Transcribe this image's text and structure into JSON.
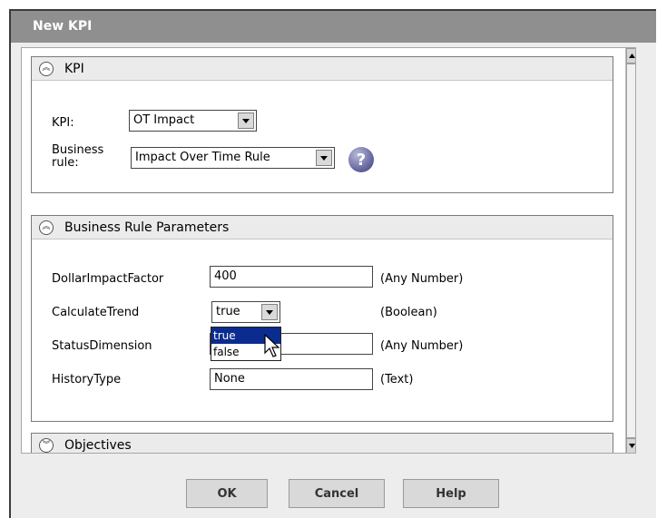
{
  "dialog": {
    "title": "New KPI"
  },
  "kpi_section": {
    "title": "KPI",
    "kpi_label": "KPI:",
    "kpi_value": "OT Impact",
    "business_rule_label_1": "Business",
    "business_rule_label_2": "rule:",
    "business_rule_value": "Impact Over Time Rule",
    "help_icon": "question-icon"
  },
  "params_section": {
    "title": "Business Rule Parameters",
    "rows": [
      {
        "name": "DollarImpactFactor",
        "value": "400",
        "type": "(Any Number)"
      },
      {
        "name": "CalculateTrend",
        "value": "true",
        "type": "(Boolean)"
      },
      {
        "name": "StatusDimension",
        "value": "",
        "type": "(Any Number)"
      },
      {
        "name": "HistoryType",
        "value": "None",
        "type": "(Text)"
      }
    ],
    "dropdown_options": [
      "true",
      "false"
    ]
  },
  "objectives_section": {
    "title": "Objectives"
  },
  "buttons": {
    "ok": "OK",
    "cancel": "Cancel",
    "help": "Help"
  },
  "colors": {
    "titlebar": "#8f8f8f",
    "selection": "#0b2c8e",
    "help_icon": "#5d5f98"
  }
}
